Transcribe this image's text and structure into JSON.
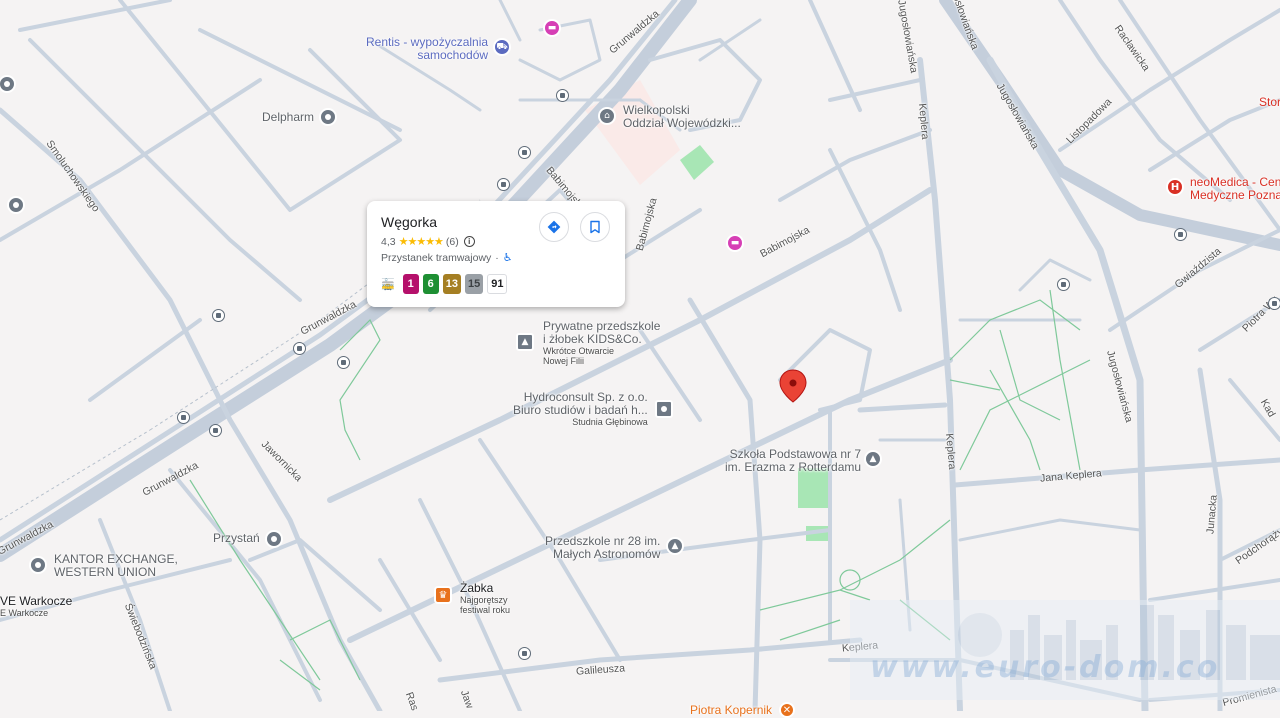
{
  "colors": {
    "road": "#c9d3df",
    "map_bg": "#f5f3f3",
    "green_area": "#a8e6b5",
    "path_green": "#7fc99a",
    "marker": "#ea4335"
  },
  "place_card": {
    "name": "Węgorka",
    "rating": "4,3",
    "stars": "★★★★★",
    "review_count": "(6)",
    "category": "Przystanek tramwajowy",
    "category_sep": "·",
    "info_icon": "i",
    "accessible_icon": "wheelchair-icon",
    "tram_glyph": "🚋",
    "lines": [
      {
        "label": "1",
        "color": "#b5106b",
        "text_color": "#ffffff"
      },
      {
        "label": "6",
        "color": "#1e8f33",
        "text_color": "#ffffff"
      },
      {
        "label": "13",
        "color": "#a57f23",
        "text_color": "#ffffff"
      },
      {
        "label": "15",
        "color": "#9aa0a6",
        "text_color": "#3c4043"
      },
      {
        "label": "91",
        "color": "#ffffff",
        "text_color": "#202124"
      }
    ]
  },
  "pois": {
    "rentis_line1": "Rentis - wypożyczalnia",
    "rentis_line2": "samochodów",
    "delpharm": "Delpharm",
    "wielkopolski_line1": "Wielkopolski",
    "wielkopolski_line2": "Oddział Wojewódzki...",
    "kids_line1": "Prywatne przedszkole",
    "kids_line2": "i żłobek KIDS&Co.",
    "kids_sub1": "Wkrótce Otwarcie",
    "kids_sub2": "Nowej Filii",
    "hydro_line1": "Hydroconsult Sp. z o.o.",
    "hydro_line2": "Biuro studiów i badań h...",
    "hydro_sub": "Studnia Głębinowa",
    "szkola_line1": "Szkoła Podstawowa nr 7",
    "szkola_line2": "im. Erazma z Rotterdamu",
    "przedszkole_line1": "Przedszkole nr 28 im.",
    "przedszkole_line2": "Małych Astronomów",
    "przystan": "Przystań",
    "kantor_line1": "KANTOR EXCHANGE,",
    "kantor_line2": "WESTERN UNION",
    "zabka": "Żabka",
    "zabka_sub1": "Najgorętszy",
    "zabka_sub2": "festiwal roku",
    "warkocze_line1": "VE Warkocze",
    "warkocze_line2": "E Warkocze",
    "neomedica_line1": "neoMedica - Cen",
    "neomedica_line2": "Medyczne Pozna",
    "stor": "Stor",
    "kopernik": "Piotra Kopernik"
  },
  "streets": {
    "grunwaldzka_top": "Grunwaldzka",
    "grunwaldzka_mid": "Grunwaldzka",
    "grunwaldzka_low": "Grunwaldzka",
    "grunwaldzka_left": "Grunwaldzka",
    "babimojska_upper": "Babimojska",
    "babimojska_vert": "Babimojska",
    "babimojska_lower": "Babimojska",
    "smoluchowskiego": "Smoluchowskiego",
    "jawornicka": "Jawornicka",
    "swiebodzinska": "Świebodzińska",
    "jugoslowianska_top": "Jugosłowiańska",
    "jugoslowianska_mid": "Jugosłowiańska",
    "jugoslowianska_low": "Jugosłowiańska",
    "jugoslowianska_far": "Jugosłowiańska",
    "keplera_top": "Keplera",
    "keplera_mid": "Keplera",
    "keplera_low": "Keplera",
    "jana_keplera": "Jana Keplera",
    "listopadowa": "Listopadowa",
    "raclawicka": "Racławicka",
    "gwiazdzista": "Gwiaździsta",
    "piotra_wysockiego": "Piotra Wy",
    "kad": "Kad",
    "junacka": "Junacka",
    "podchorazych": "Podchorąży",
    "galileusza": "Galileusza",
    "promienista": "Promienista",
    "ras": "Ras",
    "jaw": "Jaw"
  },
  "watermark": "www.euro-dom.co"
}
